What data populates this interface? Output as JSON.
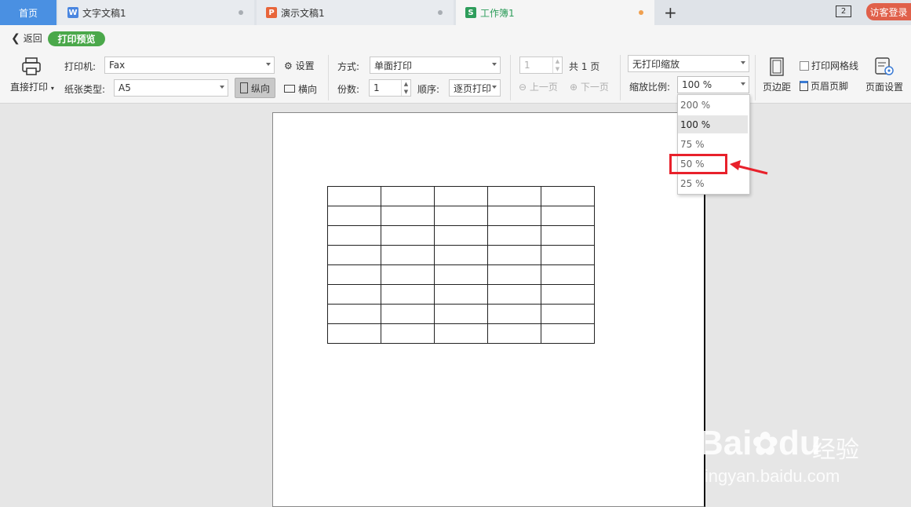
{
  "tabs": {
    "home": "首页",
    "doc": "文字文稿1",
    "ppt": "演示文稿1",
    "xls": "工作簿1",
    "doc_icon": "W",
    "ppt_icon": "P",
    "xls_icon": "S",
    "window_count": "2",
    "login": "访客登录"
  },
  "header": {
    "back": "返回",
    "mode": "打印预览"
  },
  "print": {
    "direct_print": "直接打印",
    "printer_label": "打印机:",
    "printer_value": "Fax",
    "settings": "设置",
    "paper_label": "纸张类型:",
    "paper_value": "A5",
    "portrait": "纵向",
    "landscape": "横向",
    "method_label": "方式:",
    "method_value": "单面打印",
    "copies_label": "份数:",
    "copies_value": "1",
    "order_label": "顺序:",
    "order_value": "逐页打印",
    "page_value": "1",
    "total_pages": "共 1 页",
    "prev_page": "上一页",
    "next_page": "下一页",
    "scale_mode": "无打印缩放",
    "scale_label": "缩放比例:",
    "scale_value": "100 %",
    "margins": "页边距",
    "print_gridlines": "打印网格线",
    "header_footer": "页眉页脚",
    "page_setup": "页面设置"
  },
  "scale_options": [
    "200 %",
    "100 %",
    "75 %",
    "50 %",
    "25 %"
  ],
  "selected_option": "100 %",
  "highlighted_option": "50 %",
  "watermark": {
    "brand": "Bai",
    "brand2": "du",
    "cn": "经验",
    "url": "jingyan.baidu.com"
  },
  "colors": {
    "accent": "#4a90e2",
    "green": "#4aa84a",
    "highlight": "#e8212b",
    "login": "#e0604a"
  }
}
